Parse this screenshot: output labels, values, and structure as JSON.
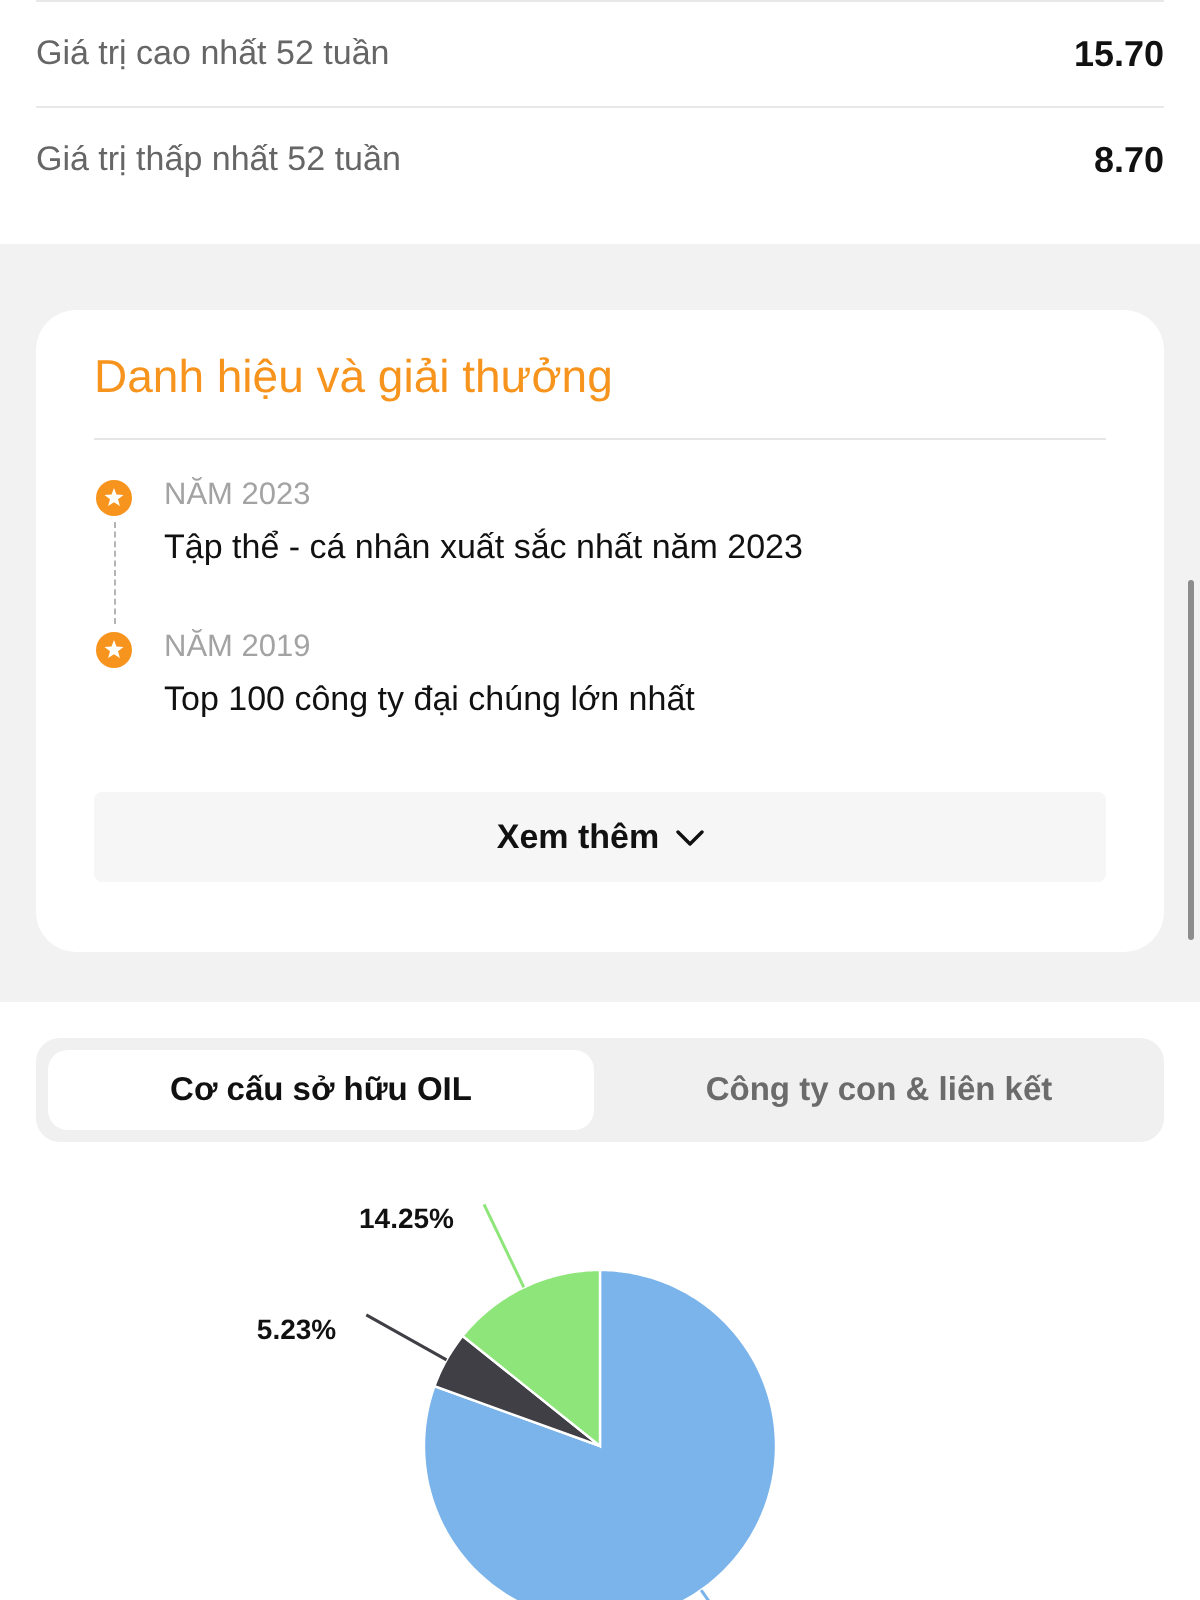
{
  "stats": [
    {
      "label": "Giá trị cao nhất 52 tuần",
      "value": "15.70"
    },
    {
      "label": "Giá trị thấp nhất 52 tuần",
      "value": "8.70"
    }
  ],
  "awards": {
    "title": "Danh hiệu và giải thưởng",
    "items": [
      {
        "year": "NĂM 2023",
        "name": "Tập thể - cá nhân xuất sắc nhất năm 2023"
      },
      {
        "year": "NĂM 2019",
        "name": "Top 100 công ty đại chúng lớn nhất"
      }
    ],
    "more_button": "Xem thêm"
  },
  "ownership": {
    "tabs": [
      {
        "label": "Cơ cấu sở hữu OIL",
        "selected": true
      },
      {
        "label": "Công ty con & liên kết",
        "selected": false
      }
    ],
    "chart_data": {
      "type": "pie",
      "values": [
        80.52,
        5.23,
        14.25
      ],
      "colors": [
        "#7ab4ea",
        "#3f3f45",
        "#8ee57a"
      ],
      "value_labels": [
        null,
        "5.23%",
        "14.25%"
      ]
    }
  }
}
